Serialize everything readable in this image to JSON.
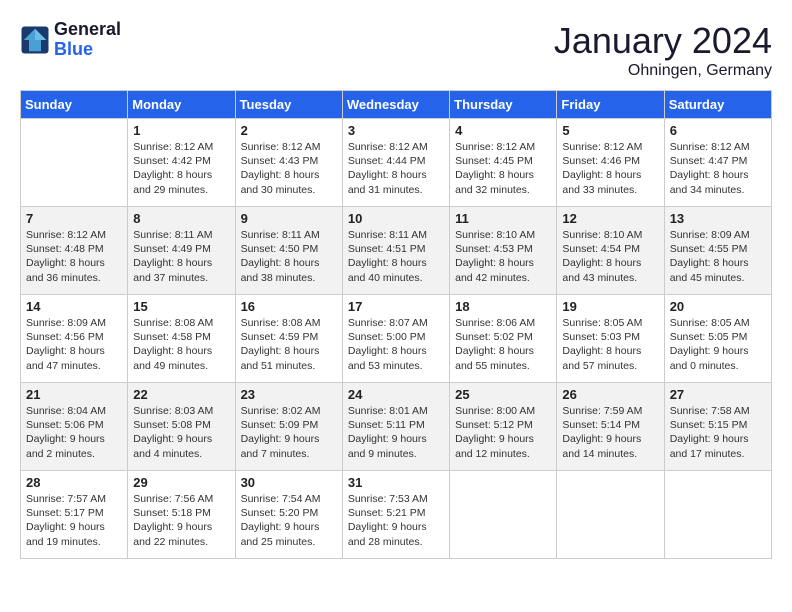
{
  "header": {
    "logo_line1": "General",
    "logo_line2": "Blue",
    "month": "January 2024",
    "location": "Ohningen, Germany"
  },
  "weekdays": [
    "Sunday",
    "Monday",
    "Tuesday",
    "Wednesday",
    "Thursday",
    "Friday",
    "Saturday"
  ],
  "weeks": [
    [
      {
        "day": "",
        "text": ""
      },
      {
        "day": "1",
        "text": "Sunrise: 8:12 AM\nSunset: 4:42 PM\nDaylight: 8 hours\nand 29 minutes."
      },
      {
        "day": "2",
        "text": "Sunrise: 8:12 AM\nSunset: 4:43 PM\nDaylight: 8 hours\nand 30 minutes."
      },
      {
        "day": "3",
        "text": "Sunrise: 8:12 AM\nSunset: 4:44 PM\nDaylight: 8 hours\nand 31 minutes."
      },
      {
        "day": "4",
        "text": "Sunrise: 8:12 AM\nSunset: 4:45 PM\nDaylight: 8 hours\nand 32 minutes."
      },
      {
        "day": "5",
        "text": "Sunrise: 8:12 AM\nSunset: 4:46 PM\nDaylight: 8 hours\nand 33 minutes."
      },
      {
        "day": "6",
        "text": "Sunrise: 8:12 AM\nSunset: 4:47 PM\nDaylight: 8 hours\nand 34 minutes."
      }
    ],
    [
      {
        "day": "7",
        "text": "Sunrise: 8:12 AM\nSunset: 4:48 PM\nDaylight: 8 hours\nand 36 minutes."
      },
      {
        "day": "8",
        "text": "Sunrise: 8:11 AM\nSunset: 4:49 PM\nDaylight: 8 hours\nand 37 minutes."
      },
      {
        "day": "9",
        "text": "Sunrise: 8:11 AM\nSunset: 4:50 PM\nDaylight: 8 hours\nand 38 minutes."
      },
      {
        "day": "10",
        "text": "Sunrise: 8:11 AM\nSunset: 4:51 PM\nDaylight: 8 hours\nand 40 minutes."
      },
      {
        "day": "11",
        "text": "Sunrise: 8:10 AM\nSunset: 4:53 PM\nDaylight: 8 hours\nand 42 minutes."
      },
      {
        "day": "12",
        "text": "Sunrise: 8:10 AM\nSunset: 4:54 PM\nDaylight: 8 hours\nand 43 minutes."
      },
      {
        "day": "13",
        "text": "Sunrise: 8:09 AM\nSunset: 4:55 PM\nDaylight: 8 hours\nand 45 minutes."
      }
    ],
    [
      {
        "day": "14",
        "text": "Sunrise: 8:09 AM\nSunset: 4:56 PM\nDaylight: 8 hours\nand 47 minutes."
      },
      {
        "day": "15",
        "text": "Sunrise: 8:08 AM\nSunset: 4:58 PM\nDaylight: 8 hours\nand 49 minutes."
      },
      {
        "day": "16",
        "text": "Sunrise: 8:08 AM\nSunset: 4:59 PM\nDaylight: 8 hours\nand 51 minutes."
      },
      {
        "day": "17",
        "text": "Sunrise: 8:07 AM\nSunset: 5:00 PM\nDaylight: 8 hours\nand 53 minutes."
      },
      {
        "day": "18",
        "text": "Sunrise: 8:06 AM\nSunset: 5:02 PM\nDaylight: 8 hours\nand 55 minutes."
      },
      {
        "day": "19",
        "text": "Sunrise: 8:05 AM\nSunset: 5:03 PM\nDaylight: 8 hours\nand 57 minutes."
      },
      {
        "day": "20",
        "text": "Sunrise: 8:05 AM\nSunset: 5:05 PM\nDaylight: 9 hours\nand 0 minutes."
      }
    ],
    [
      {
        "day": "21",
        "text": "Sunrise: 8:04 AM\nSunset: 5:06 PM\nDaylight: 9 hours\nand 2 minutes."
      },
      {
        "day": "22",
        "text": "Sunrise: 8:03 AM\nSunset: 5:08 PM\nDaylight: 9 hours\nand 4 minutes."
      },
      {
        "day": "23",
        "text": "Sunrise: 8:02 AM\nSunset: 5:09 PM\nDaylight: 9 hours\nand 7 minutes."
      },
      {
        "day": "24",
        "text": "Sunrise: 8:01 AM\nSunset: 5:11 PM\nDaylight: 9 hours\nand 9 minutes."
      },
      {
        "day": "25",
        "text": "Sunrise: 8:00 AM\nSunset: 5:12 PM\nDaylight: 9 hours\nand 12 minutes."
      },
      {
        "day": "26",
        "text": "Sunrise: 7:59 AM\nSunset: 5:14 PM\nDaylight: 9 hours\nand 14 minutes."
      },
      {
        "day": "27",
        "text": "Sunrise: 7:58 AM\nSunset: 5:15 PM\nDaylight: 9 hours\nand 17 minutes."
      }
    ],
    [
      {
        "day": "28",
        "text": "Sunrise: 7:57 AM\nSunset: 5:17 PM\nDaylight: 9 hours\nand 19 minutes."
      },
      {
        "day": "29",
        "text": "Sunrise: 7:56 AM\nSunset: 5:18 PM\nDaylight: 9 hours\nand 22 minutes."
      },
      {
        "day": "30",
        "text": "Sunrise: 7:54 AM\nSunset: 5:20 PM\nDaylight: 9 hours\nand 25 minutes."
      },
      {
        "day": "31",
        "text": "Sunrise: 7:53 AM\nSunset: 5:21 PM\nDaylight: 9 hours\nand 28 minutes."
      },
      {
        "day": "",
        "text": ""
      },
      {
        "day": "",
        "text": ""
      },
      {
        "day": "",
        "text": ""
      }
    ]
  ]
}
